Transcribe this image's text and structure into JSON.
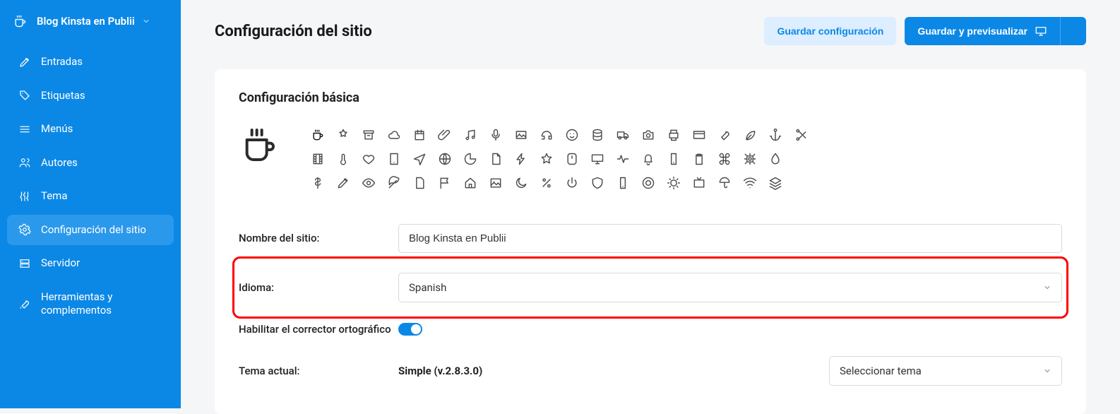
{
  "site_name": "Blog Kinsta en Publii",
  "sidebar": {
    "items": [
      {
        "label": "Entradas"
      },
      {
        "label": "Etiquetas"
      },
      {
        "label": "Menús"
      },
      {
        "label": "Autores"
      },
      {
        "label": "Tema"
      },
      {
        "label": "Configuración del sitio"
      },
      {
        "label": "Servidor"
      },
      {
        "label": "Herramientas y complementos"
      }
    ]
  },
  "header": {
    "title": "Configuración del sitio",
    "save": "Guardar configuración",
    "save_preview": "Guardar y previsualizar"
  },
  "section": {
    "title": "Configuración básica"
  },
  "fields": {
    "site_name_label": "Nombre del sitio:",
    "site_name_value": "Blog Kinsta en Publii",
    "language_label": "Idioma:",
    "language_value": "Spanish",
    "spellcheck_label": "Habilitar el corrector ortográfico",
    "spellcheck_on": true,
    "theme_label": "Tema actual:",
    "theme_value": "Simple (v.2.8.3.0)",
    "theme_select": "Seleccionar tema"
  },
  "icon_picker": [
    "mug",
    "badge",
    "archive",
    "cloud",
    "calendar",
    "clip",
    "music",
    "mic",
    "photo",
    "headphones",
    "smile",
    "db",
    "truck",
    "camera",
    "printer",
    "card",
    "wrench",
    "leaf",
    "anchor",
    "scissors",
    "film",
    "thermo",
    "heart",
    "tablet",
    "send",
    "globe",
    "chart",
    "doc",
    "bolt",
    "star",
    "mouse",
    "monitor",
    "pulse",
    "bell",
    "mobile",
    "clipboard",
    "cmd",
    "cpu",
    "drop",
    "",
    "dollar",
    "pen",
    "eye",
    "feather",
    "file",
    "flag",
    "home",
    "image",
    "moon",
    "percent",
    "power",
    "shield",
    "phone",
    "target",
    "sun",
    "tv",
    "umbrella",
    "wifi",
    "layers",
    ""
  ]
}
